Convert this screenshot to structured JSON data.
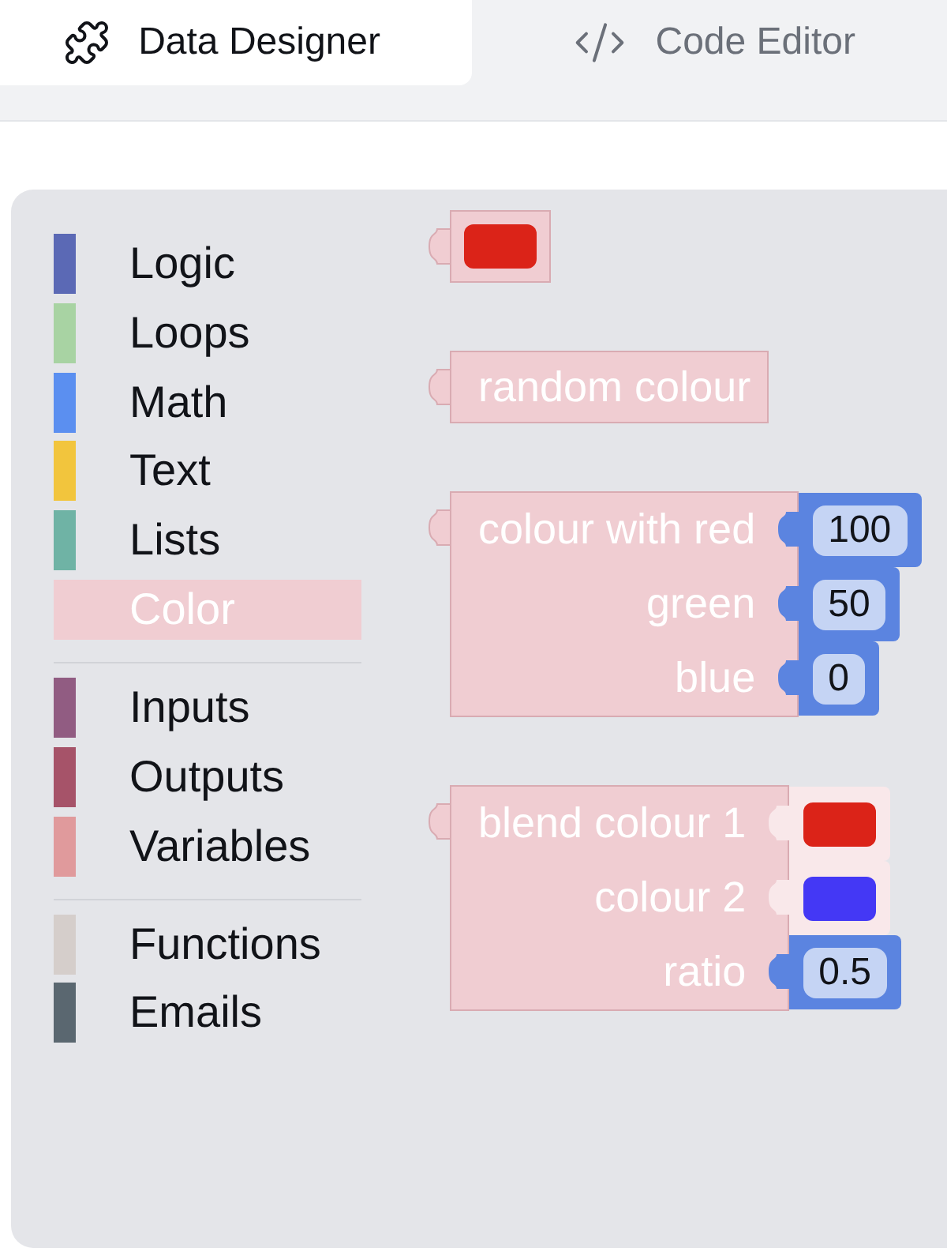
{
  "tabs": [
    {
      "kind": "designer",
      "label": "Data Designer",
      "selected": true
    },
    {
      "kind": "code",
      "label": "Code Editor",
      "selected": false
    }
  ],
  "toolbox": {
    "sections": [
      {
        "categories": [
          {
            "label": "Logic",
            "color": "#5b69b5",
            "selected": false
          },
          {
            "label": "Loops",
            "color": "#a8d3a3",
            "selected": false
          },
          {
            "label": "Math",
            "color": "#5b8ff0",
            "selected": false
          },
          {
            "label": "Text",
            "color": "#f2c53d",
            "selected": false
          },
          {
            "label": "Lists",
            "color": "#6fb3a5",
            "selected": false
          },
          {
            "label": "Color",
            "color": "#f0cdd2",
            "selected": true
          }
        ]
      },
      {
        "categories": [
          {
            "label": "Inputs",
            "color": "#915c82",
            "selected": false
          },
          {
            "label": "Outputs",
            "color": "#a65369",
            "selected": false
          },
          {
            "label": "Variables",
            "color": "#e09a9c",
            "selected": false
          }
        ]
      },
      {
        "categories": [
          {
            "label": "Functions",
            "color": "#d5cecb",
            "selected": false
          },
          {
            "label": "Emails",
            "color": "#5a6770",
            "selected": false
          }
        ]
      }
    ]
  },
  "workspace": {
    "blocks": [
      {
        "kind": "swatch",
        "color": "#db2318"
      },
      {
        "kind": "label",
        "label": "random colour"
      },
      {
        "kind": "inputs",
        "rows": [
          {
            "label": "colour with red",
            "input": {
              "kind": "number",
              "value": "100"
            }
          },
          {
            "label": "green",
            "input": {
              "kind": "number",
              "value": "50"
            }
          },
          {
            "label": "blue",
            "input": {
              "kind": "number",
              "value": "0"
            }
          }
        ]
      },
      {
        "kind": "inputs",
        "rows": [
          {
            "label": "blend colour 1",
            "input": {
              "kind": "colour",
              "color": "#db2318"
            }
          },
          {
            "label": "colour 2",
            "input": {
              "kind": "colour",
              "color": "#4438f5"
            }
          },
          {
            "label": "ratio",
            "input": {
              "kind": "number",
              "value": "0.5"
            }
          }
        ]
      }
    ]
  }
}
